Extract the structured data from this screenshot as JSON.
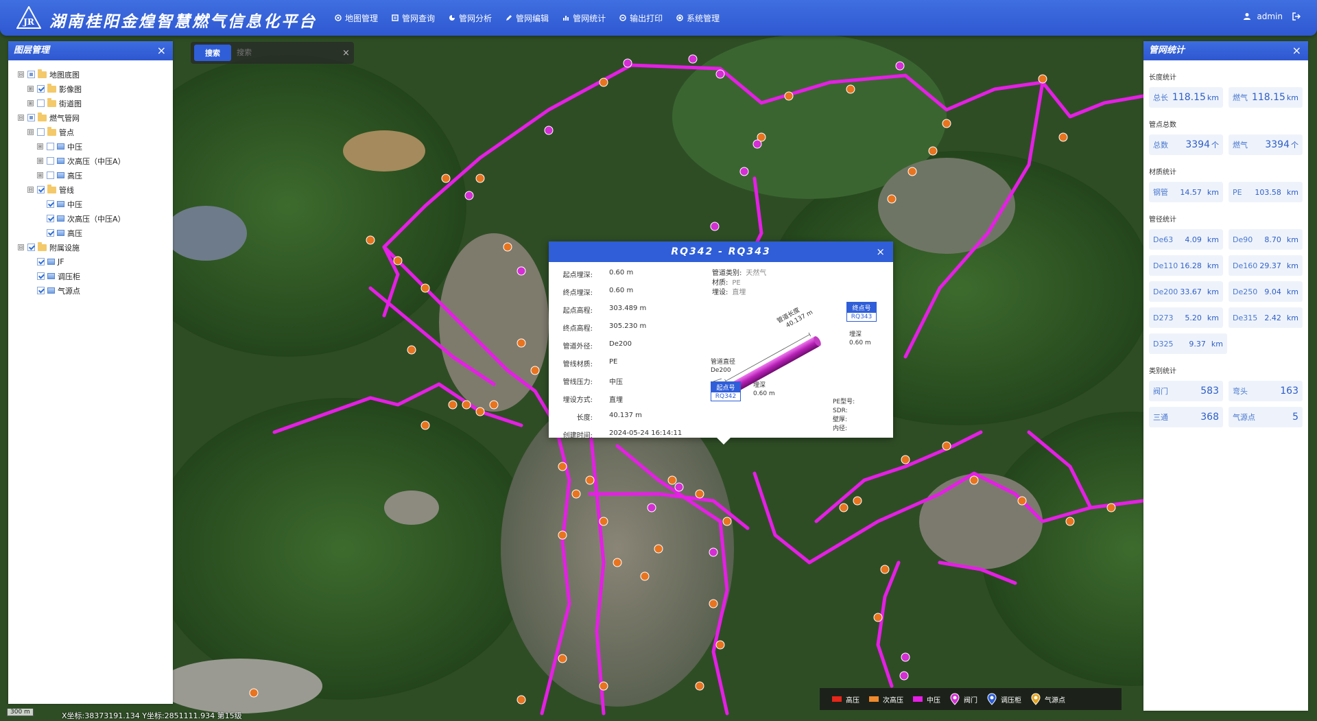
{
  "header": {
    "logo_text": "JR",
    "title": "湖南桂阳金煌智慧燃气信息化平台",
    "nav": [
      {
        "label": "地图管理",
        "icon": "map-pin-icon"
      },
      {
        "label": "管网查询",
        "icon": "query-icon"
      },
      {
        "label": "管网分析",
        "icon": "analysis-icon"
      },
      {
        "label": "管网编辑",
        "icon": "edit-icon"
      },
      {
        "label": "管网统计",
        "icon": "chart-icon"
      },
      {
        "label": "输出打印",
        "icon": "print-icon"
      },
      {
        "label": "系统管理",
        "icon": "system-icon"
      }
    ],
    "user": "admin"
  },
  "layer_panel": {
    "title": "图层管理",
    "close": "×",
    "tree": [
      {
        "label": "地图底图",
        "level": 0,
        "toggle": "⊟",
        "check": "partial",
        "icon": "folder"
      },
      {
        "label": "影像图",
        "level": 1,
        "toggle": "⊞",
        "check": "checked",
        "icon": "folder"
      },
      {
        "label": "街道图",
        "level": 1,
        "toggle": "⊞",
        "check": "none",
        "icon": "folder"
      },
      {
        "label": "燃气管网",
        "level": 0,
        "toggle": "⊟",
        "check": "partial",
        "icon": "folder"
      },
      {
        "label": "管点",
        "level": 1,
        "toggle": "⊟",
        "check": "none",
        "icon": "folder"
      },
      {
        "label": "中压",
        "level": 2,
        "toggle": "⊞",
        "check": "none",
        "icon": "layer"
      },
      {
        "label": "次高压（中压A）",
        "level": 2,
        "toggle": "⊞",
        "check": "none",
        "icon": "layer"
      },
      {
        "label": "高压",
        "level": 2,
        "toggle": "⊞",
        "check": "none",
        "icon": "layer"
      },
      {
        "label": "管线",
        "level": 1,
        "toggle": "⊟",
        "check": "checked",
        "icon": "folder"
      },
      {
        "label": "中压",
        "level": 2,
        "toggle": "",
        "check": "checked",
        "icon": "layer"
      },
      {
        "label": "次高压（中压A）",
        "level": 2,
        "toggle": "",
        "check": "checked",
        "icon": "layer"
      },
      {
        "label": "高压",
        "level": 2,
        "toggle": "",
        "check": "checked",
        "icon": "layer"
      },
      {
        "label": "附属设施",
        "level": 0,
        "toggle": "⊟",
        "check": "checked",
        "icon": "folder"
      },
      {
        "label": "JF",
        "level": 1,
        "toggle": "",
        "check": "checked",
        "icon": "layer"
      },
      {
        "label": "调压柜",
        "level": 1,
        "toggle": "",
        "check": "checked",
        "icon": "layer"
      },
      {
        "label": "气源点",
        "level": 1,
        "toggle": "",
        "check": "checked",
        "icon": "layer"
      }
    ]
  },
  "search": {
    "button": "搜索",
    "placeholder": "搜索",
    "clear": "×"
  },
  "stats_panel": {
    "title": "管网统计",
    "close": "×",
    "length": {
      "title": "长度统计",
      "items": [
        {
          "label": "总长",
          "value": "118.15",
          "unit": "km"
        },
        {
          "label": "燃气",
          "value": "118.15",
          "unit": "km"
        }
      ]
    },
    "points": {
      "title": "管点总数",
      "items": [
        {
          "label": "总数",
          "value": "3394",
          "unit": "个"
        },
        {
          "label": "燃气",
          "value": "3394",
          "unit": "个"
        }
      ]
    },
    "material": {
      "title": "材质统计",
      "items": [
        {
          "label": "钢管",
          "value": "14.57",
          "unit": "km"
        },
        {
          "label": "PE",
          "value": "103.58",
          "unit": "km"
        }
      ]
    },
    "diameter": {
      "title": "管径统计",
      "items": [
        {
          "label": "De63",
          "value": "4.09",
          "unit": "km"
        },
        {
          "label": "De90",
          "value": "8.70",
          "unit": "km"
        },
        {
          "label": "De110",
          "value": "16.28",
          "unit": "km"
        },
        {
          "label": "De160",
          "value": "29.37",
          "unit": "km"
        },
        {
          "label": "De200",
          "value": "33.67",
          "unit": "km"
        },
        {
          "label": "De250",
          "value": "9.04",
          "unit": "km"
        },
        {
          "label": "D273",
          "value": "5.20",
          "unit": "km"
        },
        {
          "label": "De315",
          "value": "2.42",
          "unit": "km"
        },
        {
          "label": "D325",
          "value": "9.37",
          "unit": "km"
        }
      ]
    },
    "category": {
      "title": "类别统计",
      "items": [
        {
          "label": "阀门",
          "value": "583"
        },
        {
          "label": "弯头",
          "value": "163"
        },
        {
          "label": "三通",
          "value": "368"
        },
        {
          "label": "气源点",
          "value": "5"
        }
      ]
    }
  },
  "popup": {
    "title": "RQ342 - RQ343",
    "close": "×",
    "fields": [
      {
        "k": "起点埋深:",
        "v": "0.60 m"
      },
      {
        "k": "终点埋深:",
        "v": "0.60 m"
      },
      {
        "k": "起点高程:",
        "v": "303.489 m"
      },
      {
        "k": "终点高程:",
        "v": "305.230 m"
      },
      {
        "k": "管道外径:",
        "v": "De200"
      },
      {
        "k": "管线材质:",
        "v": "PE"
      },
      {
        "k": "管线压力:",
        "v": "中压"
      },
      {
        "k": "埋设方式:",
        "v": "直埋"
      },
      {
        "k": "长度:",
        "v": "40.137 m"
      },
      {
        "k": "创建时间:",
        "v": "2024-05-24 16:14:11"
      }
    ],
    "meta": [
      {
        "k": "管道类别:",
        "v": "天然气"
      },
      {
        "k": "材质:",
        "v": "PE"
      },
      {
        "k": "埋设:",
        "v": "直埋"
      }
    ],
    "diagram": {
      "start_label": "起点号",
      "start_id": "RQ342",
      "end_label": "终点号",
      "end_id": "RQ343",
      "length_label": "管道长度",
      "length_value": "40.137 m",
      "diameter_label": "管道直径",
      "diameter_value": "De200",
      "start_depth_label": "埋深",
      "start_depth_value": "0.60 m",
      "end_depth_label": "埋深",
      "end_depth_value": "0.60 m"
    },
    "pe_info": [
      "PE型号:",
      "SDR:",
      "壁厚:",
      "内径:"
    ]
  },
  "legend": [
    {
      "label": "高压",
      "color": "#e8261a",
      "kind": "line"
    },
    {
      "label": "次高压",
      "color": "#f08a2c",
      "kind": "line"
    },
    {
      "label": "中压",
      "color": "#e61ee6",
      "kind": "line"
    },
    {
      "label": "阀门",
      "color": "#d42ed4",
      "kind": "pin"
    },
    {
      "label": "调压柜",
      "color": "#2e5fd8",
      "kind": "pin"
    },
    {
      "label": "气源点",
      "color": "#e6a51e",
      "kind": "pin"
    }
  ],
  "map_footer": {
    "scale": "300 m",
    "coords": "X坐标:38373191.134 Y坐标:2851111.934 第15级"
  }
}
